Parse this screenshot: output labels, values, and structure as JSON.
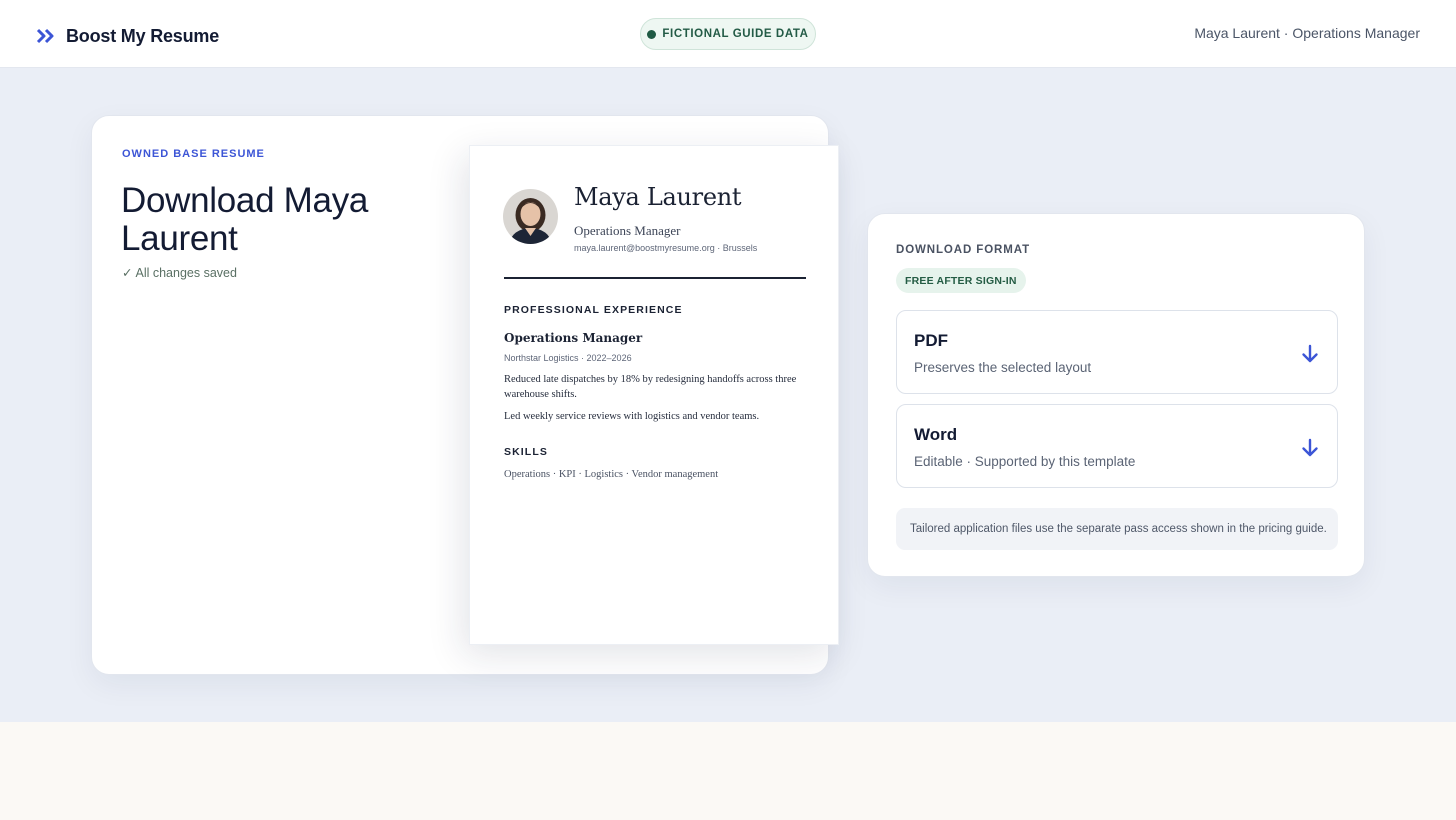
{
  "header": {
    "brand_name": "Boost My Resume",
    "brand_icon": "double-chevron-right-icon",
    "guide_pill": "FICTIONAL GUIDE DATA",
    "user_meta": "Maya Laurent · Operations Manager"
  },
  "editor": {
    "eyebrow": "OWNED BASE RESUME",
    "title": "Download Maya Laurent",
    "saved_check": "✓",
    "saved_status": "All changes saved"
  },
  "resume": {
    "name": "Maya Laurent",
    "role": "Operations Manager",
    "contact": "maya.laurent@boostmyresume.org · Brussels",
    "experience_heading": "PROFESSIONAL EXPERIENCE",
    "job_title": "Operations Manager",
    "company": "Northstar Logistics · 2022–2026",
    "bullets": [
      "Reduced late dispatches by 18% by redesigning handoffs across three warehouse shifts.",
      "Led weekly service reviews with logistics and vendor teams."
    ],
    "skills_heading": "SKILLS",
    "skills": "Operations · KPI · Logistics · Vendor management"
  },
  "download": {
    "heading": "DOWNLOAD FORMAT",
    "badge": "FREE AFTER SIGN-IN",
    "options": [
      {
        "title": "PDF",
        "subtitle": "Preserves the selected layout",
        "icon": "download-arrow-icon"
      },
      {
        "title": "Word",
        "subtitle": "Editable · Supported by this template",
        "icon": "download-arrow-icon"
      }
    ],
    "note": "Tailored application files use the separate pass access shown in the pricing guide."
  },
  "colors": {
    "accent": "#3c55d6",
    "navy": "#131b33",
    "stage_bg": "#eaeef6",
    "success_green": "#245c44"
  }
}
